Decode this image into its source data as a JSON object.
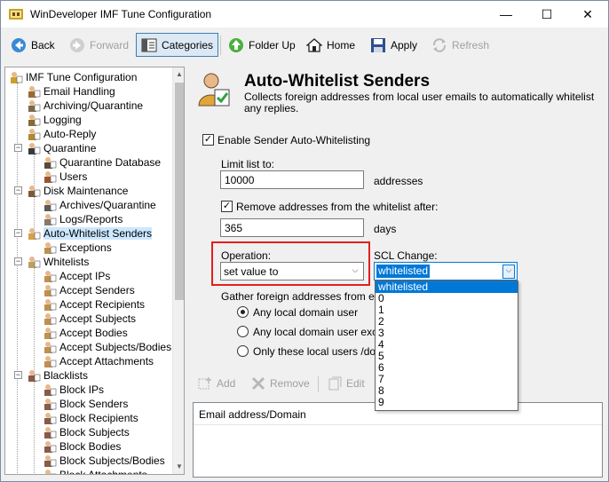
{
  "window": {
    "title": "WinDeveloper IMF Tune Configuration",
    "minimize_glyph": "—",
    "maximize_glyph": "☐",
    "close_glyph": "✕"
  },
  "toolbar": {
    "back": "Back",
    "forward": "Forward",
    "categories": "Categories",
    "folder_up": "Folder Up",
    "home": "Home",
    "apply": "Apply",
    "refresh": "Refresh"
  },
  "tree": {
    "root": "IMF Tune Configuration",
    "items": [
      {
        "label": "Email Handling"
      },
      {
        "label": "Archiving/Quarantine"
      },
      {
        "label": "Logging"
      },
      {
        "label": "Auto-Reply"
      },
      {
        "label": "Quarantine"
      },
      {
        "label": "Quarantine Database"
      },
      {
        "label": "Users"
      },
      {
        "label": "Disk Maintenance"
      },
      {
        "label": "Archives/Quarantine"
      },
      {
        "label": "Logs/Reports"
      },
      {
        "label": "Auto-Whitelist Senders"
      },
      {
        "label": "Exceptions"
      },
      {
        "label": "Whitelists"
      },
      {
        "label": "Accept IPs"
      },
      {
        "label": "Accept Senders"
      },
      {
        "label": "Accept Recipients"
      },
      {
        "label": "Accept Subjects"
      },
      {
        "label": "Accept Bodies"
      },
      {
        "label": "Accept Subjects/Bodies"
      },
      {
        "label": "Accept Attachments"
      },
      {
        "label": "Blacklists"
      },
      {
        "label": "Block IPs"
      },
      {
        "label": "Block Senders"
      },
      {
        "label": "Block Recipients"
      },
      {
        "label": "Block Subjects"
      },
      {
        "label": "Block Bodies"
      },
      {
        "label": "Block Subjects/Bodies"
      },
      {
        "label": "Block Attachments"
      }
    ],
    "expander_minus": "−"
  },
  "panel": {
    "title": "Auto-Whitelist Senders",
    "description": "Collects foreign addresses from local user emails to automatically whitelist any replies.",
    "enable_label": "Enable Sender Auto-Whitelisting",
    "enable_checked": true,
    "limit_label": "Limit list to:",
    "limit_value": "10000",
    "limit_unit": "addresses",
    "remove_label": "Remove addresses from the whitelist after:",
    "remove_checked": true,
    "remove_value": "365",
    "remove_unit": "days",
    "operation_label": "Operation:",
    "operation_value": "set value to",
    "scl_label": "SCL Change:",
    "scl_value": "whitelisted",
    "gather_label": "Gather foreign addresses from ema",
    "radio_any": "Any local domain user",
    "radio_except": "Any local domain user exce",
    "radio_only": "Only these local users /dom",
    "check_glyph": "✓",
    "dropdown_glyph": "⌵"
  },
  "list_toolbar": {
    "add": "Add",
    "remove": "Remove",
    "edit": "Edit"
  },
  "grid": {
    "column": "Email address/Domain"
  },
  "scl_options": [
    "whitelisted",
    "0",
    "1",
    "2",
    "3",
    "4",
    "5",
    "6",
    "7",
    "8",
    "9"
  ],
  "colors": {
    "highlight_box": "#e1201f",
    "selection": "#0078d7"
  }
}
